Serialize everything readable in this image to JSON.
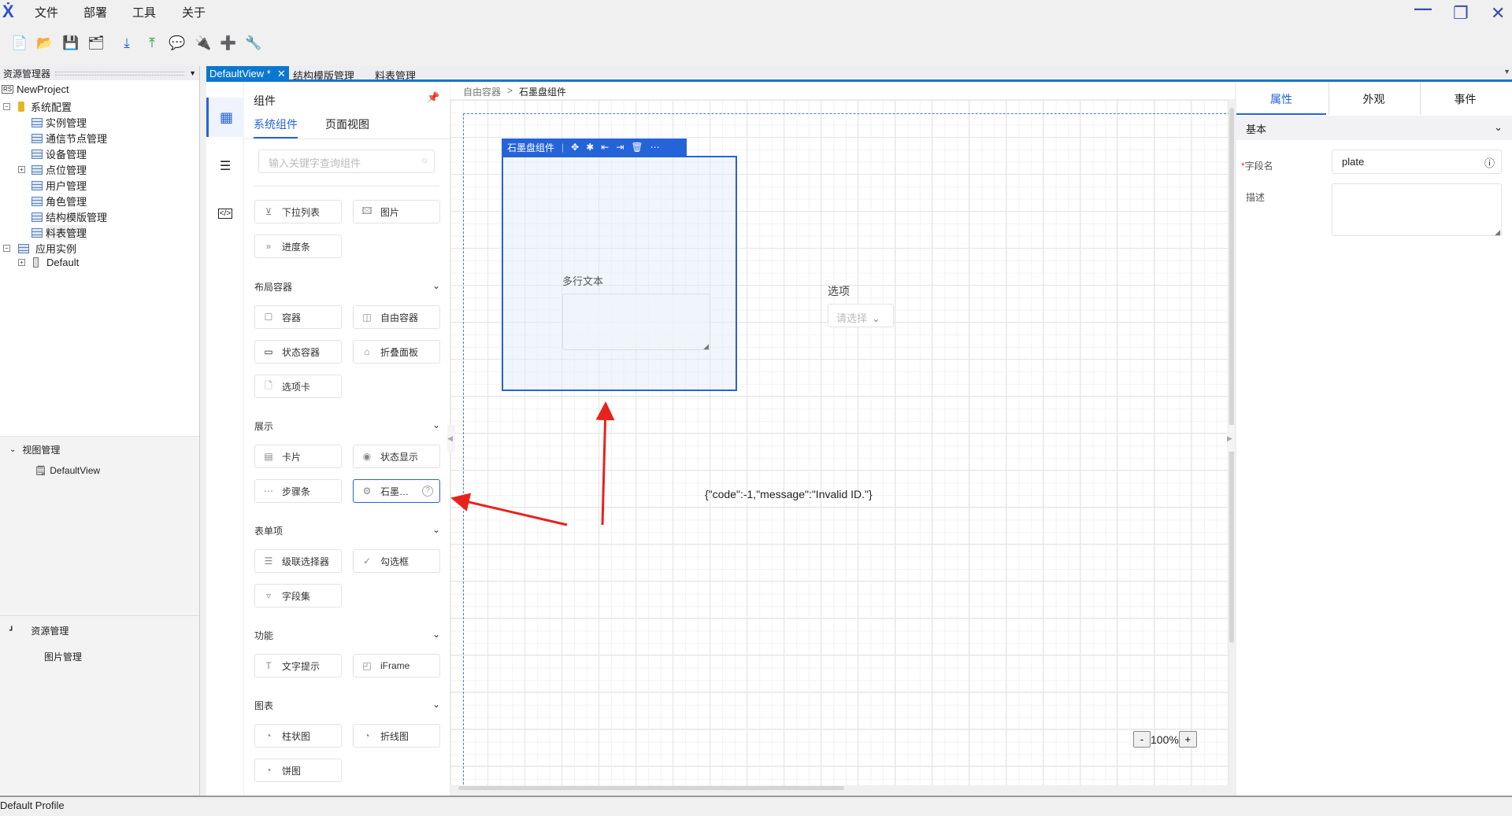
{
  "menu": [
    "文件",
    "部署",
    "工具",
    "关于"
  ],
  "toolbar_icons": [
    "new-file-icon",
    "open-folder-icon",
    "save-icon",
    "save-all-icon",
    "import-icon",
    "export-icon",
    "help-icon",
    "connect-icon",
    "add-device-icon",
    "tools-icon"
  ],
  "explorer": {
    "title": "资源管理器",
    "tree": [
      {
        "label": "NewProject",
        "level": 0
      },
      {
        "label": "系统配置",
        "level": 1
      },
      {
        "label": "实例管理",
        "level": 2
      },
      {
        "label": "通信节点管理",
        "level": 2
      },
      {
        "label": "设备管理",
        "level": 2
      },
      {
        "label": "点位管理",
        "level": 2
      },
      {
        "label": "用户管理",
        "level": 2
      },
      {
        "label": "角色管理",
        "level": 2
      },
      {
        "label": "结构模版管理",
        "level": 2
      },
      {
        "label": "料表管理",
        "level": 2
      },
      {
        "label": "应用实例",
        "level": 1
      },
      {
        "label": "Default",
        "level": 2
      }
    ],
    "view_mgmt": "视图管理",
    "default_view": "DefaultView",
    "res_mgmt": "资源管理",
    "image_mgmt": "图片管理"
  },
  "status": "Default Profile",
  "tabs": [
    {
      "label": "DefaultView *",
      "active": true
    },
    {
      "label": "结构模版管理"
    },
    {
      "label": "料表管理"
    }
  ],
  "components": {
    "title": "组件",
    "tabs": [
      "系统组件",
      "页面视图"
    ],
    "search_placeholder": "输入关键字查询组件",
    "top": [
      "下拉列表",
      "图片",
      "进度条"
    ],
    "sections": [
      {
        "title": "布局容器",
        "items": [
          "容器",
          "自由容器",
          "状态容器",
          "折叠面板",
          "选项卡"
        ]
      },
      {
        "title": "展示",
        "items": [
          "卡片",
          "状态显示",
          "步骤条",
          "石墨…"
        ]
      },
      {
        "title": "表单项",
        "items": [
          "级联选择器",
          "勾选框",
          "字段集"
        ]
      },
      {
        "title": "功能",
        "items": [
          "文字提示",
          "iFrame"
        ]
      },
      {
        "title": "图表",
        "items": [
          "柱状图",
          "折线图",
          "饼图"
        ]
      }
    ]
  },
  "breadcrumb": [
    "自由容器",
    ">",
    "石墨盘组件"
  ],
  "canvas": {
    "selected_title": "石墨盘组件",
    "textarea_label": "多行文本",
    "select_label": "选项",
    "select_placeholder": "请选择",
    "error_text": "{\"code\":-1,\"message\":\"Invalid ID.\"}",
    "zoom": "100%",
    "zoom_minus": "-",
    "zoom_plus": "+"
  },
  "props": {
    "tabs": [
      "属性",
      "外观",
      "事件"
    ],
    "section": "基本",
    "field_label": "字段名",
    "field_value": "plate",
    "desc_label": "描述",
    "required_mark": "*"
  },
  "colors": {
    "accent": "#2563d9",
    "tab_blue": "#0a78d0",
    "arrow": "#e8231c"
  }
}
